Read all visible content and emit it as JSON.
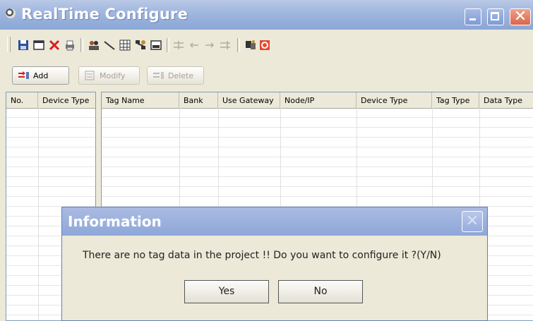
{
  "window": {
    "title": "RealTime Configure"
  },
  "toolbar": {
    "icons": [
      "save-icon",
      "window-icon",
      "delete-icon",
      "print-icon",
      "users-icon",
      "line-icon",
      "grid-icon",
      "network-icon",
      "screen-icon",
      "align-icon",
      "left-arrow-icon",
      "right-arrow-icon",
      "align2-icon",
      "device-icon",
      "stop-icon"
    ]
  },
  "actions": {
    "add": "Add",
    "modify": "Modify",
    "delete": "Delete"
  },
  "left_table": {
    "columns": [
      "No.",
      "Device Type"
    ]
  },
  "right_table": {
    "columns": [
      "Tag Name",
      "Bank",
      "Use Gateway",
      "Node/IP",
      "Device Type",
      "Tag Type",
      "Data Type"
    ]
  },
  "dialog": {
    "title": "Information",
    "message": "There are no tag data in the project !! Do you want to configure it ?(Y/N)",
    "yes": "Yes",
    "no": "No"
  },
  "colors": {
    "title_bar": "#9fb6de",
    "close": "#d9664a",
    "face": "#ece9d8"
  }
}
